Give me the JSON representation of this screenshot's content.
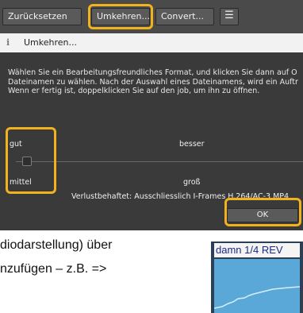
{
  "toolbar": {
    "reset_label": "Zurücksetzen",
    "invert_label": "Umkehren...",
    "convert_label": "Convert...",
    "menu_glyph": "☰"
  },
  "dialog": {
    "title": "Umkehren...",
    "info_glyph": "i",
    "description_lines": [
      "Wählen Sie ein Bearbeitungsfreundliches Format, und klicken Sie dann auf O",
      "Dateinamen zu wählen. Nach der Auswahl eines Dateinamens, wird ein Auftr",
      "Wenn er fertig ist, doppelklicken Sie auf den job, um ihn zu öffnen."
    ],
    "quality_labels": {
      "low": "gut",
      "high": "besser"
    },
    "size_labels": {
      "low": "mittel",
      "high": "groß"
    },
    "format_description": "Verlustbehaftet: Ausschliesslich I-Frames H.264/AC-3 MP4",
    "slider_value": 0,
    "ok_label": "OK"
  },
  "body_text": {
    "line1": "diodarstellung) über",
    "line2": "nzufügen – z.B. =>"
  },
  "thumbnail": {
    "label": "damn 1/4 REV"
  },
  "colors": {
    "highlight": "#f2b21c",
    "panel_bg": "#3a3a3a",
    "waveform": "#5aa8d8"
  }
}
